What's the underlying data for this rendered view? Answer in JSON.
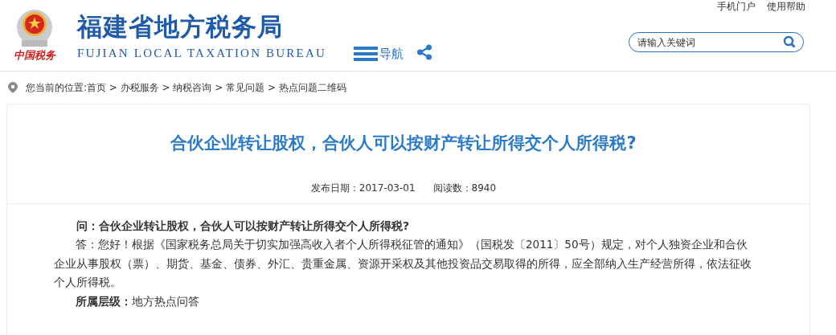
{
  "header": {
    "logo_caption": "中国税务",
    "site_title": "福建省地方税务局",
    "site_subtitle": "FUJIAN LOCAL TAXATION BUREAU",
    "nav_label": "导航",
    "top_links": [
      "手机门户",
      "使用帮助"
    ],
    "search": {
      "placeholder": "请输入关键词"
    }
  },
  "breadcrumb": "您当前的位置:首页 > 办税服务 > 纳税咨询 > 常见问题 > 热点问题二维码",
  "article": {
    "title": "合伙企业转让股权，合伙人可以按财产转让所得交个人所得税?",
    "publish_date": "发布日期：2017-03-01",
    "read_count": "阅读数：8940",
    "question": "问：合伙企业转让股权，合伙人可以按财产转让所得交个人所得税?",
    "answer": "答：您好！根据《国家税务总局关于切实加强高收入者个人所得税征管的通知》（国税发〔2011〕50号）规定，对个人独资企业和合伙企业从事股权（票）、期货、基金、债券、外汇、贵重金属、资源开采权及其他投资品交易取得的所得，应全部纳入生产经营所得，依法征收个人所得税。",
    "level": "**所属层级：**地方热点问答"
  }
}
